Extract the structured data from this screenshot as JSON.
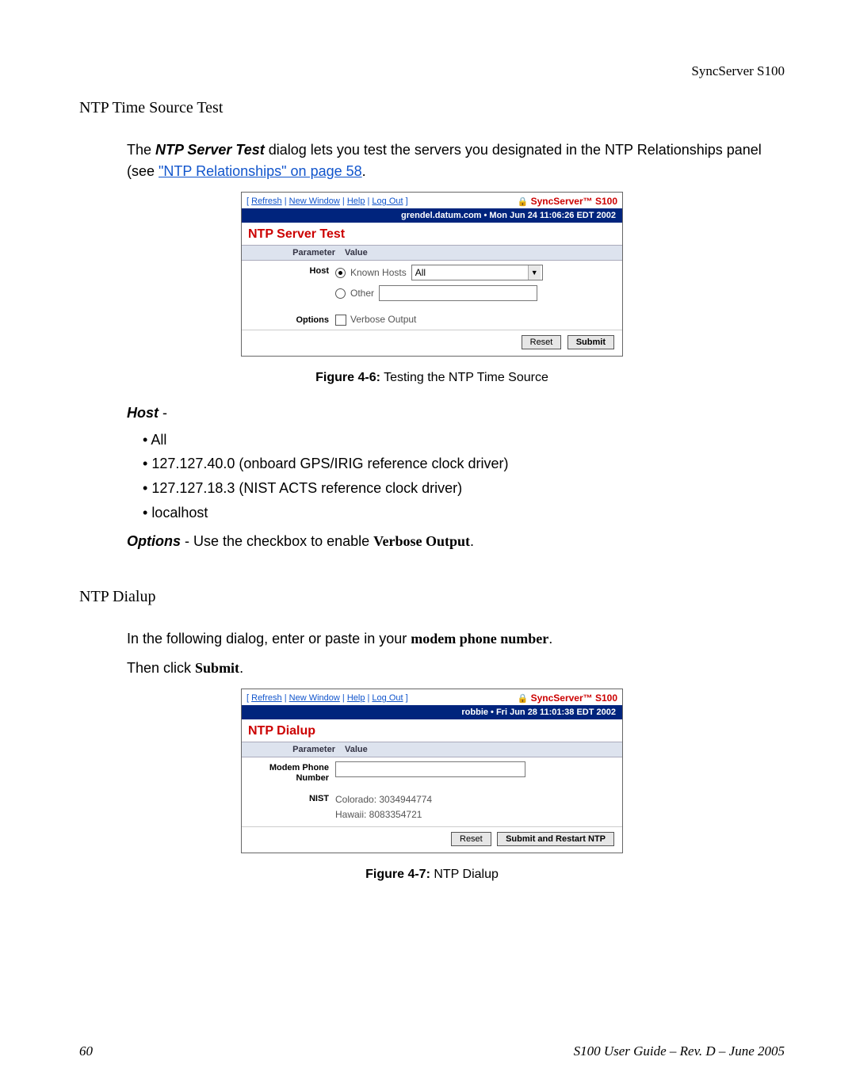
{
  "header_right": "SyncServer S100",
  "section1_title": "NTP Time Source Test",
  "intro1_pre": "The ",
  "intro1_bold": "NTP Server Test",
  "intro1_mid": " dialog lets you test the servers you designated in the NTP Relationships panel (see ",
  "intro1_link": "\"NTP Relationships\" on page 58",
  "intro1_post": ".",
  "dialog1": {
    "top_refresh": "Refresh",
    "top_newwin": "New Window",
    "top_help": "Help",
    "top_logout": "Log Out",
    "brand": "SyncServer™ S100",
    "bluebar": "grendel.datum.com  •  Mon Jun 24 11:06:26 EDT 2002",
    "title": "NTP Server Test",
    "hdr_param": "Parameter",
    "hdr_value": "Value",
    "row_host": "Host",
    "known_hosts": "Known Hosts",
    "dropdown_all": "All",
    "other": "Other",
    "row_options": "Options",
    "verbose": "Verbose Output",
    "btn_reset": "Reset",
    "btn_submit": "Submit"
  },
  "fig1_label": "Figure 4-6:",
  "fig1_text": "  Testing the NTP Time Source",
  "host_label": "Host",
  "host_dash": " -",
  "list_items": [
    "All",
    "127.127.40.0 (onboard GPS/IRIG reference clock driver)",
    "127.127.18.3 (NIST ACTS reference clock driver)",
    "localhost"
  ],
  "options_pre_b": "Options",
  "options_mid": " - Use the checkbox to enable ",
  "options_bold2": "Verbose Output",
  "options_post": ".",
  "section2_title": "NTP Dialup",
  "intro2_pre": "In the following dialog, enter or paste in your ",
  "intro2_bold": "modem phone number",
  "intro2_post": ".",
  "intro2b_pre": "Then click ",
  "intro2b_bold": "Submit",
  "intro2b_post": ".",
  "dialog2": {
    "bluebar": "robbie  •  Fri Jun 28 11:01:38 EDT 2002",
    "title": "NTP Dialup",
    "row_modem": "Modem Phone Number",
    "row_nist": "NIST",
    "nist_l1": "Colorado:  3034944774",
    "nist_l2": "Hawaii:      8083354721",
    "btn_reset": "Reset",
    "btn_submit": "Submit and Restart NTP"
  },
  "fig2_label": "Figure 4-7:",
  "fig2_text": "  NTP Dialup",
  "footer_left": "60",
  "footer_right": "S100 User Guide – Rev. D – June 2005"
}
